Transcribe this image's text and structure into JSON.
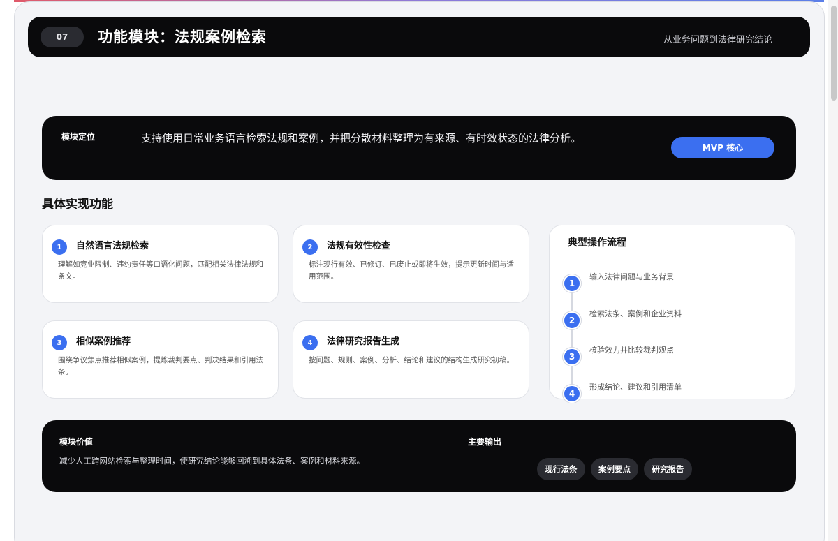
{
  "header": {
    "number": "07",
    "title": "功能模块：法规案例检索",
    "subtitle": "从业务问题到法律研究结论"
  },
  "positioning": {
    "label": "模块定位",
    "text": "支持使用日常业务语言检索法规和案例，并把分散材料整理为有来源、有时效状态的法律分析。",
    "badge": "MVP 核心"
  },
  "section_title": "具体实现功能",
  "features": [
    {
      "num": "1",
      "title": "自然语言法规检索",
      "desc": "理解如竞业限制、违约责任等口语化问题，匹配相关法律法规和条文。"
    },
    {
      "num": "2",
      "title": "法规有效性检查",
      "desc": "标注现行有效、已修订、已废止或即将生效，提示更新时间与适用范围。"
    },
    {
      "num": "3",
      "title": "相似案例推荐",
      "desc": "围绕争议焦点推荐相似案例，提炼裁判要点、判决结果和引用法条。"
    },
    {
      "num": "4",
      "title": "法律研究报告生成",
      "desc": "按问题、规则、案例、分析、结论和建议的结构生成研究初稿。"
    }
  ],
  "flow": {
    "title": "典型操作流程",
    "steps": [
      {
        "num": "1",
        "text": "输入法律问题与业务背景"
      },
      {
        "num": "2",
        "text": "检索法条、案例和企业资料"
      },
      {
        "num": "3",
        "text": "核验效力并比较裁判观点"
      },
      {
        "num": "4",
        "text": "形成结论、建议和引用清单"
      }
    ]
  },
  "value": {
    "label": "模块价值",
    "text": "减少人工跨网站检索与整理时间，使研究结论能够回溯到具体法条、案例和材料来源。",
    "output_label": "主要输出",
    "outputs": [
      "现行法条",
      "案例要点",
      "研究报告"
    ]
  },
  "colors": {
    "accent": "#3b6ff0",
    "dark": "#0a0a0c",
    "page_bg": "#f3f4f7"
  }
}
